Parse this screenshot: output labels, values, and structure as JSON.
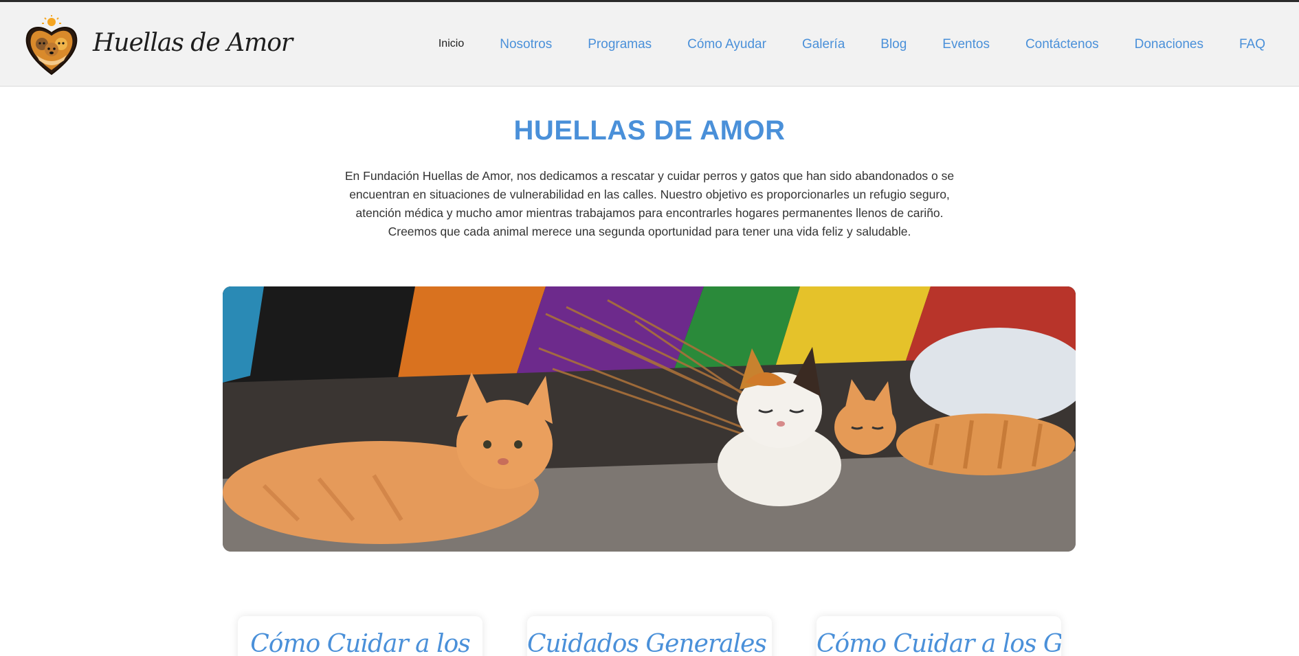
{
  "header": {
    "brand": "Huellas de Amor",
    "nav": [
      {
        "label": "Inicio",
        "active": true
      },
      {
        "label": "Nosotros"
      },
      {
        "label": "Programas"
      },
      {
        "label": "Cómo Ayudar"
      },
      {
        "label": "Galería"
      },
      {
        "label": "Blog"
      },
      {
        "label": "Eventos"
      },
      {
        "label": "Contáctenos"
      },
      {
        "label": "Donaciones"
      },
      {
        "label": "FAQ"
      }
    ]
  },
  "hero": {
    "title": "HUELLAS DE AMOR",
    "intro": "En Fundación Huellas de Amor, nos dedicamos a rescatar y cuidar perros y gatos que han sido abandonados o se encuentran en situaciones de vulnerabilidad en las calles. Nuestro objetivo es proporcionarles un refugio seguro, atención médica y mucho amor mientras trabajamos para encontrarles hogares permanentes llenos de cariño. Creemos que cada animal merece una segunda oportunidad para tener una vida feliz y saludable."
  },
  "cards": [
    {
      "title": "Cómo Cuidar a los"
    },
    {
      "title": "Cuidados Generales para"
    },
    {
      "title": "Cómo Cuidar a los Gatos"
    }
  ],
  "colors": {
    "accent": "#4a90d9",
    "header_bg": "#f2f2f2",
    "text": "#333333"
  },
  "icons": {
    "logo": "heart-paw-logo-icon"
  }
}
